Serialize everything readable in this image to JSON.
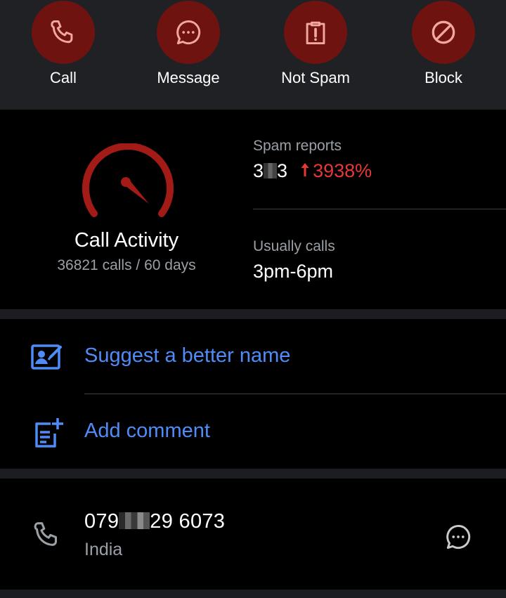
{
  "actions": [
    {
      "label": "Call",
      "icon": "phone-icon"
    },
    {
      "label": "Message",
      "icon": "message-icon"
    },
    {
      "label": "Not Spam",
      "icon": "clipboard-alert-icon"
    },
    {
      "label": "Block",
      "icon": "block-icon"
    }
  ],
  "stats": {
    "activity_title": "Call Activity",
    "activity_sub": "36821 calls / 60 days",
    "spam_label": "Spam reports",
    "spam_value_prefix": "3",
    "spam_value_suffix": "3",
    "spam_trend": "3938%",
    "usually_label": "Usually calls",
    "usually_value": "3pm-6pm"
  },
  "suggestions": {
    "suggest_name": "Suggest a better name",
    "add_comment": "Add comment"
  },
  "number": {
    "prefix": "079",
    "suffix": "29 6073",
    "country": "India"
  },
  "colors": {
    "action_circle": "#6e1310",
    "action_icon": "#f2a7a1",
    "gauge": "#a31b17",
    "trend": "#e53935",
    "link": "#4f8cf7",
    "action_bar_bg": "#202124"
  }
}
